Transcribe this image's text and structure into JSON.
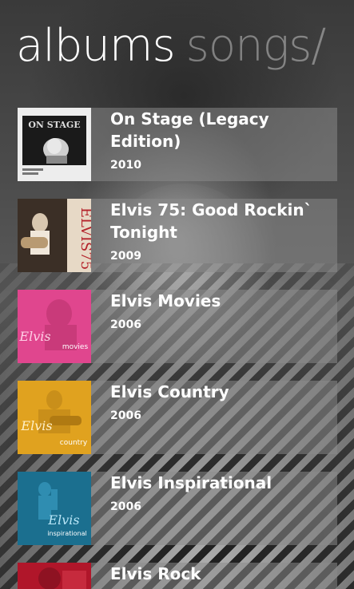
{
  "pivot": {
    "active": "albums",
    "next": "songs/"
  },
  "albums": [
    {
      "title": "On Stage (Legacy Edition)",
      "year": "2010",
      "art_icon": "on-stage-cover-art"
    },
    {
      "title": "Elvis 75: Good Rockin` Tonight",
      "year": "2009",
      "art_icon": "elvis-75-cover-art"
    },
    {
      "title": "Elvis Movies",
      "year": "2006",
      "art_icon": "elvis-movies-cover-art"
    },
    {
      "title": "Elvis Country",
      "year": "2006",
      "art_icon": "elvis-country-cover-art"
    },
    {
      "title": "Elvis Inspirational",
      "year": "2006",
      "art_icon": "elvis-inspirational-cover-art"
    },
    {
      "title": "Elvis Rock",
      "year": "",
      "art_icon": "elvis-rock-cover-art"
    }
  ],
  "cover_text": {
    "on_stage": "ON STAGE",
    "elvis75": "ELVIS75",
    "movies_brand": "Elvis",
    "movies_sub": "movies",
    "country_brand": "Elvis",
    "country_sub": "country",
    "insp_brand": "Elvis",
    "insp_sub": "inspirational"
  },
  "colors": {
    "tile_overlay": "rgba(140,140,140,0.52)",
    "movies_pink": "#e0468e",
    "country_yellow": "#e0a21f",
    "inspirational_teal": "#1b6f8f",
    "rock_red": "#b0162a"
  }
}
